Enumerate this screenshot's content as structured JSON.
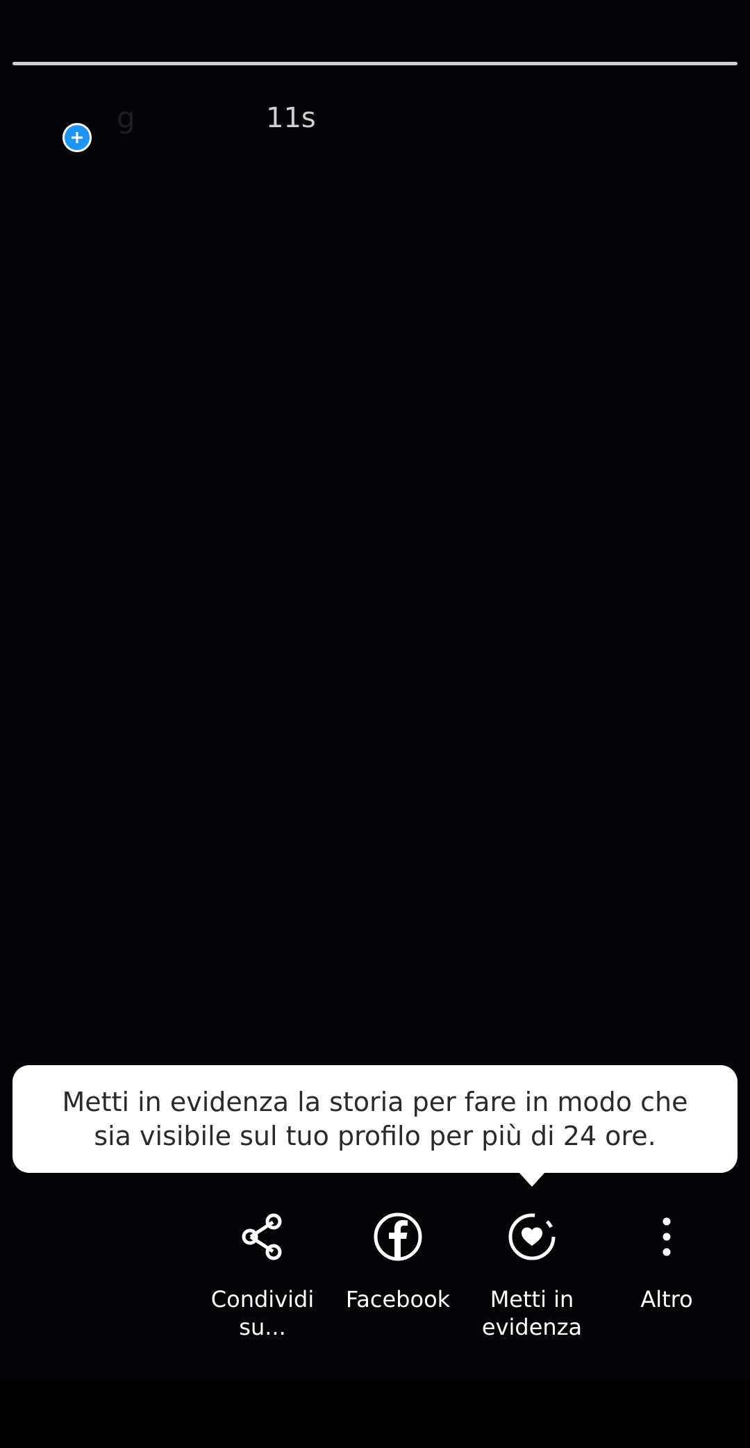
{
  "story": {
    "username": "g",
    "timestamp": "11s",
    "progress": 1.0
  },
  "tooltip": {
    "text": "Metti in evidenza la storia per fare in modo che sia visibile sul tuo profilo per più di 24 ore."
  },
  "actions": [
    {
      "label": "Condividi su...",
      "icon": "share-icon"
    },
    {
      "label": "Facebook",
      "icon": "facebook-icon"
    },
    {
      "label": "Metti in evidenza",
      "icon": "highlight-heart-icon"
    },
    {
      "label": "Altro",
      "icon": "more-vertical-icon"
    }
  ],
  "colors": {
    "background": "#050406",
    "badge_blue": "#1e95f5",
    "tooltip_bg": "#ffffff",
    "tooltip_text": "#2a2a2a",
    "timestamp": "#cfcfcf"
  }
}
